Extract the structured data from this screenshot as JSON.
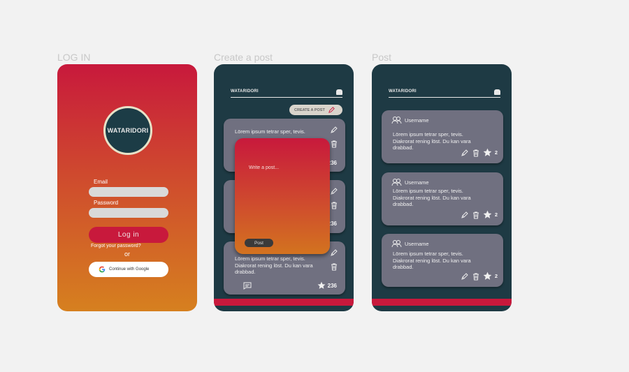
{
  "labels": {
    "login": "LOG IN",
    "create": "Create a post",
    "post": "Post"
  },
  "login": {
    "logo": "WATARIDORI",
    "email_label": "Email",
    "password_label": "Password",
    "login_button": "Log in",
    "forgot": "Forgot your password?",
    "or": "or",
    "google_button": "Continue with Google"
  },
  "create": {
    "brand": "WATARIDORI",
    "create_button": "CREATE A POST",
    "cards": [
      {
        "text": "Lörem ipsum tetrar sper, tevis.",
        "stars": "236"
      },
      {
        "text": "",
        "stars": "236"
      },
      {
        "text": "Lörem ipsum tetrar sper, tevis. Diakrorat rening löst. Du kan vara drabbad.",
        "stars": "236"
      }
    ],
    "modal": {
      "placeholder": "Write a post...",
      "post_button": "Post"
    }
  },
  "post": {
    "brand": "WATARIDORI",
    "cards": [
      {
        "user": "Username",
        "text": "Lörem ipsum tetrar sper, tevis. Diakrorat rening löst. Du kan vara drabbad.",
        "stars": "2"
      },
      {
        "user": "Username",
        "text": "Lörem ipsum tetrar sper, tevis. Diakrorat rening löst. Du kan vara drabbad.",
        "stars": "2"
      },
      {
        "user": "Username",
        "text": "Lörem ipsum tetrar sper, tevis. Diakrorat rening löst. Du kan vara drabbad.",
        "stars": "2"
      }
    ]
  },
  "colors": {
    "brand_red": "#c8193c",
    "dark": "#1e3a44",
    "card": "#707080"
  }
}
